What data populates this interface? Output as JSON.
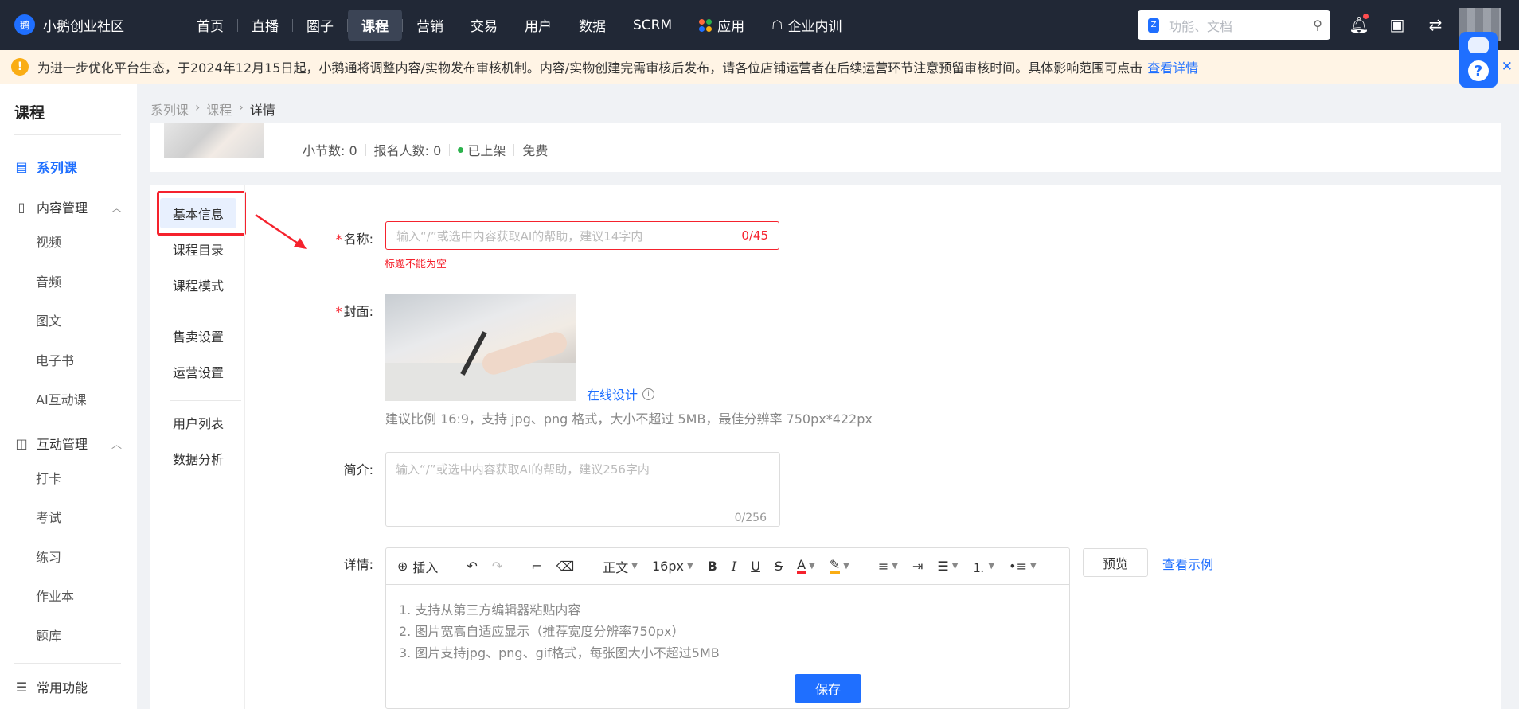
{
  "brand": {
    "name": "小鹅创业社区",
    "logo_glyph": "鹅"
  },
  "nav": {
    "items": [
      {
        "label": "首页"
      },
      {
        "label": "直播"
      },
      {
        "label": "圈子"
      },
      {
        "label": "课程",
        "active": true
      },
      {
        "label": "营销"
      },
      {
        "label": "交易"
      },
      {
        "label": "用户"
      },
      {
        "label": "数据"
      },
      {
        "label": "SCRM"
      },
      {
        "label": "应用",
        "icon": "apps-grid-icon"
      },
      {
        "label": "企业内训",
        "icon": "org-tree-icon"
      }
    ]
  },
  "search": {
    "placeholder": "功能、文档",
    "logo_glyph": "Z"
  },
  "notice": {
    "text": "为进一步优化平台生态，于2024年12月15日起，小鹅通将调整内容/实物发布审核机制。内容/实物创建完需审核后发布，请各位店铺运营者在后续运营环节注意预留审核时间。具体影响范围可点击",
    "link": "查看详情",
    "close": "✕"
  },
  "sidebar": {
    "title": "课程",
    "active_item": "系列课",
    "groups": [
      {
        "label": "内容管理",
        "items": [
          "视频",
          "音频",
          "图文",
          "电子书",
          "AI互动课"
        ]
      },
      {
        "label": "互动管理",
        "items": [
          "打卡",
          "考试",
          "练习",
          "作业本",
          "题库"
        ]
      }
    ],
    "bottom": "常用功能"
  },
  "breadcrumb": [
    "系列课",
    "课程",
    "详情"
  ],
  "course_meta": {
    "lessons": "小节数: 0",
    "enrolled": "报名人数: 0",
    "status": "已上架",
    "price": "免费"
  },
  "subnav": [
    "基本信息",
    "课程目录",
    "课程模式",
    "售卖设置",
    "运营设置",
    "用户列表",
    "数据分析"
  ],
  "form": {
    "name_label": "名称:",
    "name_placeholder": "输入“/”或选中内容获取AI的帮助，建议14字内",
    "name_count": "0/45",
    "name_error": "标题不能为空",
    "cover_label": "封面:",
    "design_link": "在线设计",
    "cover_hint": "建议比例 16:9，支持 jpg、png 格式，大小不超过 5MB，最佳分辨率 750px*422px",
    "intro_label": "简介:",
    "intro_placeholder": "输入“/”或选中内容获取AI的帮助，建议256字内",
    "intro_count": "0/256",
    "detail_label": "详情:",
    "toolbar": {
      "insert": "插入",
      "paragraph": "正文",
      "fontsize": "16px"
    },
    "editor_lines": [
      "1. 支持从第三方编辑器粘贴内容",
      "2. 图片宽高自适应显示（推荐宽度分辨率750px）",
      "3. 图片支持jpg、png、gif格式，每张图大小不超过5MB"
    ],
    "preview": "预览",
    "example": "查看示例"
  },
  "save": "保存",
  "colors": {
    "accent": "#1f6fff",
    "topbar": "#212836",
    "error": "#f5222d",
    "notice_bg": "#fff4e5"
  }
}
